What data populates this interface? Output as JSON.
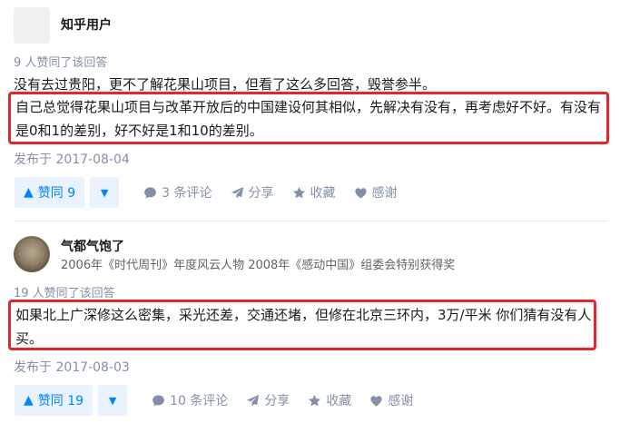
{
  "answers": [
    {
      "author": "知乎用户",
      "headline": "",
      "vote_summary": "9 人赞同了该回答",
      "text_plain": "没有去过贵阳，更不了解花果山项目，但看了这么多回答，毁誉参半。",
      "text_highlight": "自己总觉得花果山项目与改革开放后的中国建设何其相似，先解决有没有，再考虑好不好。有没有是0和1的差别，好不好是1和10的差别。",
      "date": "发布于 2017-08-04",
      "vote_label": "赞同 9",
      "comments": "3 条评论",
      "share": "分享",
      "collect": "收藏",
      "thanks": "感谢"
    },
    {
      "author": "气都气饱了",
      "headline": "2006年《时代周刊》年度风云人物 2008年《感动中国》组委会特别获得奖",
      "vote_summary": "19 人赞同了该回答",
      "text_highlight": "如果北上广深修这么密集，采光还差，交通还堵，但修在北京三环内，3万/平米 你们猜有没有人买。",
      "date": "发布于 2017-08-03",
      "vote_label": "赞同 19",
      "comments": "10 条评论",
      "share": "分享",
      "collect": "收藏",
      "thanks": "感谢"
    }
  ],
  "icons": {
    "vote_up": "triangle-up-icon",
    "vote_down": "triangle-down-icon",
    "comment": "comment-bubble-icon",
    "share": "paper-plane-icon",
    "collect": "star-icon",
    "thanks": "heart-icon"
  },
  "colors": {
    "accent": "#0084ff",
    "vote_bg": "#eaf2fd",
    "highlight_border": "#e2262b",
    "muted": "#8590a6"
  }
}
